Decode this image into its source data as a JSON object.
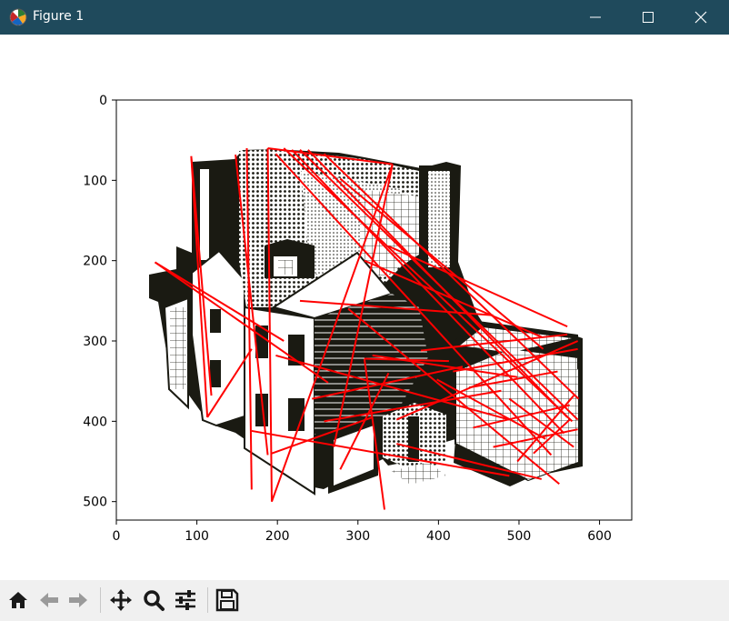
{
  "window": {
    "title": "Figure 1",
    "app_icon": "matplotlib-icon",
    "controls": [
      "minimize-icon",
      "maximize-icon",
      "close-icon"
    ],
    "titlebar_color": "#1f4a5c"
  },
  "toolbar": {
    "buttons": [
      "home-icon",
      "back-icon",
      "forward-icon",
      "pan-icon",
      "zoom-icon",
      "configure-subplots-icon",
      "save-icon"
    ]
  },
  "chart_data": {
    "type": "image-with-line-overlay",
    "image": "line drawing of a house",
    "x_ticks": [
      "0",
      "100",
      "200",
      "300",
      "400",
      "500",
      "600"
    ],
    "y_ticks": [
      "0",
      "100",
      "200",
      "300",
      "400",
      "500"
    ],
    "xlim": [
      0,
      640
    ],
    "ylim": [
      523,
      0
    ],
    "line_color": "#ff0000",
    "segments": [
      [
        93,
        70,
        113,
        395
      ],
      [
        93,
        70,
        118,
        368
      ],
      [
        48,
        202,
        208,
        300
      ],
      [
        48,
        202,
        263,
        352
      ],
      [
        113,
        395,
        168,
        310
      ],
      [
        148,
        68,
        188,
        442
      ],
      [
        162,
        60,
        168,
        485
      ],
      [
        188,
        60,
        193,
        500
      ],
      [
        188,
        60,
        343,
        80
      ],
      [
        343,
        80,
        193,
        500
      ],
      [
        343,
        80,
        270,
        432
      ],
      [
        278,
        460,
        338,
        340
      ],
      [
        208,
        60,
        566,
        400
      ],
      [
        218,
        62,
        556,
        415
      ],
      [
        238,
        62,
        560,
        395
      ],
      [
        258,
        67,
        574,
        372
      ],
      [
        198,
        67,
        540,
        442
      ],
      [
        228,
        62,
        573,
        398
      ],
      [
        278,
        98,
        530,
        310
      ],
      [
        338,
        182,
        560,
        282
      ],
      [
        308,
        200,
        528,
        295
      ],
      [
        288,
        260,
        550,
        478
      ],
      [
        193,
        440,
        318,
        395
      ],
      [
        168,
        412,
        488,
        468
      ],
      [
        243,
        372,
        430,
        332
      ],
      [
        258,
        400,
        478,
        362
      ],
      [
        348,
        398,
        573,
        300
      ],
      [
        418,
        338,
        573,
        310
      ],
      [
        438,
        358,
        548,
        338
      ],
      [
        198,
        318,
        488,
        398
      ],
      [
        318,
        318,
        498,
        345
      ],
      [
        378,
        312,
        560,
        292
      ],
      [
        228,
        250,
        468,
        268
      ],
      [
        398,
        348,
        533,
        422
      ],
      [
        443,
        408,
        563,
        380
      ],
      [
        468,
        432,
        573,
        410
      ],
      [
        498,
        450,
        568,
        368
      ],
      [
        518,
        440,
        563,
        398
      ],
      [
        488,
        372,
        568,
        432
      ],
      [
        308,
        322,
        333,
        510
      ],
      [
        308,
        322,
        413,
        325
      ],
      [
        348,
        428,
        528,
        472
      ]
    ]
  }
}
